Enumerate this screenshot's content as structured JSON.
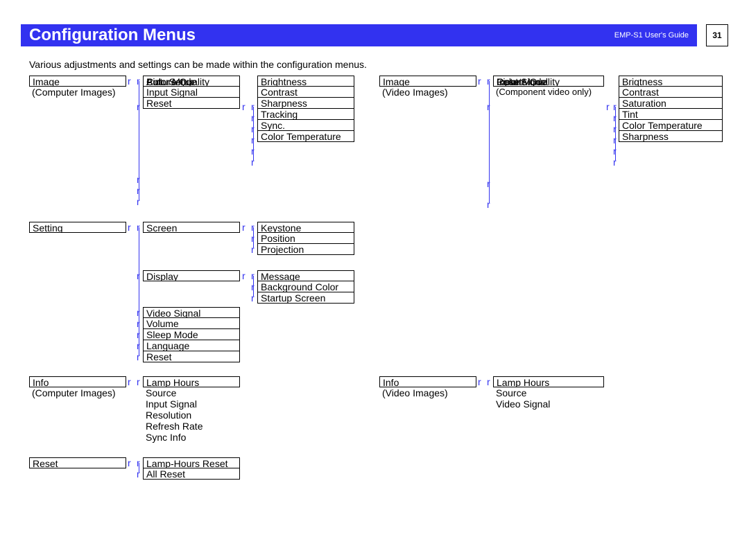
{
  "header": {
    "title": "Configuration Menus",
    "guide": "EMP-S1 User's Guide",
    "page": "31"
  },
  "intro": "Various adjustments and settings can be made within the configuration menus.",
  "left": {
    "image": {
      "label": "Image",
      "sub": "(Computer Images)"
    },
    "image_l2": {
      "colorMode": "Color Mode",
      "picQual": "Picture Quality",
      "autoSetup": "Auto Setup",
      "inputSignal": "Input Signal",
      "reset": "Reset"
    },
    "image_l3": {
      "brightness": "Brightness",
      "contrast": "Contrast",
      "sharpness": "Sharpness",
      "tracking": "Tracking",
      "sync": "Sync.",
      "colorTemp": "Color Temperature"
    },
    "setting": {
      "label": "Setting"
    },
    "setting_l2": {
      "screen": "Screen",
      "display": "Display",
      "videoSignal": "Video Signal",
      "volume": "Volume",
      "sleepMode": "Sleep Mode",
      "language": "Language",
      "reset": "Reset"
    },
    "setting_l3a": {
      "keystone": "Keystone",
      "position": "Position",
      "projection": "Projection"
    },
    "setting_l3b": {
      "message": "Message",
      "bgColor": "Background Color",
      "startup": "Startup Screen"
    },
    "info": {
      "label": "Info",
      "sub": "(Computer Images)"
    },
    "info_l2": {
      "lamp": "Lamp Hours",
      "source": "  Source",
      "inputSignal": "Input Signal",
      "resolution": "Resolution",
      "refresh": "Refresh Rate",
      "syncInfo": "Sync Info"
    },
    "reset": {
      "label": "Reset"
    },
    "reset_l2": {
      "lampReset": "Lamp-Hours Reset",
      "allReset": "All Reset"
    }
  },
  "right": {
    "image": {
      "label": "Image",
      "sub": "(Video Images)"
    },
    "image_l2": {
      "colorMode": "Color Mode",
      "picQual": "Picture Quality",
      "inputSignal": "Input Signal",
      "inputSignalSub": "(Component video only)",
      "reset": "Reset"
    },
    "image_l3": {
      "brightness": "Brigtness",
      "contrast": "Contrast",
      "saturation": "Saturation",
      "tint": "Tint",
      "colorTemp": "Color Temperature",
      "sharpness": "Sharpness"
    },
    "info": {
      "label": "Info",
      "sub": "(Video Images)"
    },
    "info_l2": {
      "lamp": "Lamp Hours",
      "source": "  Source",
      "videoSignal": "Video Signal"
    }
  }
}
